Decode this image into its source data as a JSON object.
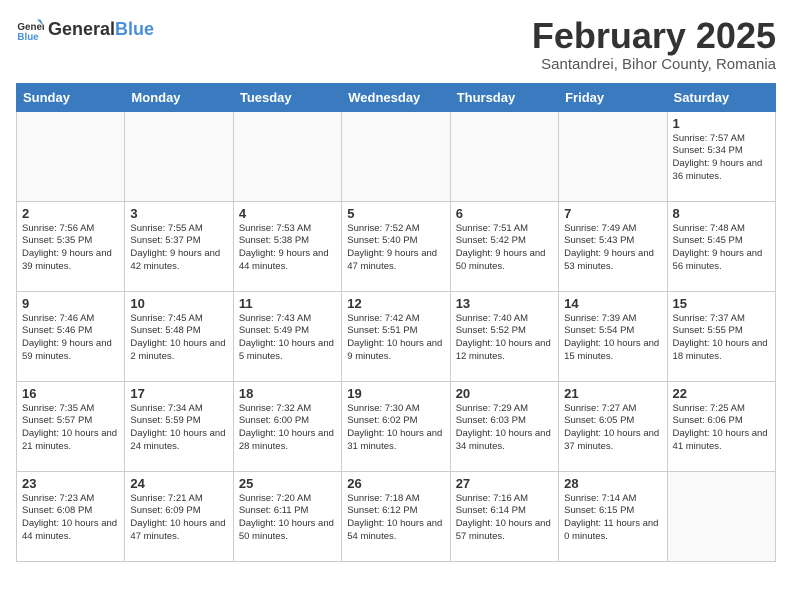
{
  "header": {
    "logo_general": "General",
    "logo_blue": "Blue",
    "title": "February 2025",
    "subtitle": "Santandrei, Bihor County, Romania"
  },
  "days_of_week": [
    "Sunday",
    "Monday",
    "Tuesday",
    "Wednesday",
    "Thursday",
    "Friday",
    "Saturday"
  ],
  "weeks": [
    [
      {
        "day": "",
        "info": ""
      },
      {
        "day": "",
        "info": ""
      },
      {
        "day": "",
        "info": ""
      },
      {
        "day": "",
        "info": ""
      },
      {
        "day": "",
        "info": ""
      },
      {
        "day": "",
        "info": ""
      },
      {
        "day": "1",
        "info": "Sunrise: 7:57 AM\nSunset: 5:34 PM\nDaylight: 9 hours and 36 minutes."
      }
    ],
    [
      {
        "day": "2",
        "info": "Sunrise: 7:56 AM\nSunset: 5:35 PM\nDaylight: 9 hours and 39 minutes."
      },
      {
        "day": "3",
        "info": "Sunrise: 7:55 AM\nSunset: 5:37 PM\nDaylight: 9 hours and 42 minutes."
      },
      {
        "day": "4",
        "info": "Sunrise: 7:53 AM\nSunset: 5:38 PM\nDaylight: 9 hours and 44 minutes."
      },
      {
        "day": "5",
        "info": "Sunrise: 7:52 AM\nSunset: 5:40 PM\nDaylight: 9 hours and 47 minutes."
      },
      {
        "day": "6",
        "info": "Sunrise: 7:51 AM\nSunset: 5:42 PM\nDaylight: 9 hours and 50 minutes."
      },
      {
        "day": "7",
        "info": "Sunrise: 7:49 AM\nSunset: 5:43 PM\nDaylight: 9 hours and 53 minutes."
      },
      {
        "day": "8",
        "info": "Sunrise: 7:48 AM\nSunset: 5:45 PM\nDaylight: 9 hours and 56 minutes."
      }
    ],
    [
      {
        "day": "9",
        "info": "Sunrise: 7:46 AM\nSunset: 5:46 PM\nDaylight: 9 hours and 59 minutes."
      },
      {
        "day": "10",
        "info": "Sunrise: 7:45 AM\nSunset: 5:48 PM\nDaylight: 10 hours and 2 minutes."
      },
      {
        "day": "11",
        "info": "Sunrise: 7:43 AM\nSunset: 5:49 PM\nDaylight: 10 hours and 5 minutes."
      },
      {
        "day": "12",
        "info": "Sunrise: 7:42 AM\nSunset: 5:51 PM\nDaylight: 10 hours and 9 minutes."
      },
      {
        "day": "13",
        "info": "Sunrise: 7:40 AM\nSunset: 5:52 PM\nDaylight: 10 hours and 12 minutes."
      },
      {
        "day": "14",
        "info": "Sunrise: 7:39 AM\nSunset: 5:54 PM\nDaylight: 10 hours and 15 minutes."
      },
      {
        "day": "15",
        "info": "Sunrise: 7:37 AM\nSunset: 5:55 PM\nDaylight: 10 hours and 18 minutes."
      }
    ],
    [
      {
        "day": "16",
        "info": "Sunrise: 7:35 AM\nSunset: 5:57 PM\nDaylight: 10 hours and 21 minutes."
      },
      {
        "day": "17",
        "info": "Sunrise: 7:34 AM\nSunset: 5:59 PM\nDaylight: 10 hours and 24 minutes."
      },
      {
        "day": "18",
        "info": "Sunrise: 7:32 AM\nSunset: 6:00 PM\nDaylight: 10 hours and 28 minutes."
      },
      {
        "day": "19",
        "info": "Sunrise: 7:30 AM\nSunset: 6:02 PM\nDaylight: 10 hours and 31 minutes."
      },
      {
        "day": "20",
        "info": "Sunrise: 7:29 AM\nSunset: 6:03 PM\nDaylight: 10 hours and 34 minutes."
      },
      {
        "day": "21",
        "info": "Sunrise: 7:27 AM\nSunset: 6:05 PM\nDaylight: 10 hours and 37 minutes."
      },
      {
        "day": "22",
        "info": "Sunrise: 7:25 AM\nSunset: 6:06 PM\nDaylight: 10 hours and 41 minutes."
      }
    ],
    [
      {
        "day": "23",
        "info": "Sunrise: 7:23 AM\nSunset: 6:08 PM\nDaylight: 10 hours and 44 minutes."
      },
      {
        "day": "24",
        "info": "Sunrise: 7:21 AM\nSunset: 6:09 PM\nDaylight: 10 hours and 47 minutes."
      },
      {
        "day": "25",
        "info": "Sunrise: 7:20 AM\nSunset: 6:11 PM\nDaylight: 10 hours and 50 minutes."
      },
      {
        "day": "26",
        "info": "Sunrise: 7:18 AM\nSunset: 6:12 PM\nDaylight: 10 hours and 54 minutes."
      },
      {
        "day": "27",
        "info": "Sunrise: 7:16 AM\nSunset: 6:14 PM\nDaylight: 10 hours and 57 minutes."
      },
      {
        "day": "28",
        "info": "Sunrise: 7:14 AM\nSunset: 6:15 PM\nDaylight: 11 hours and 0 minutes."
      },
      {
        "day": "",
        "info": ""
      }
    ]
  ]
}
